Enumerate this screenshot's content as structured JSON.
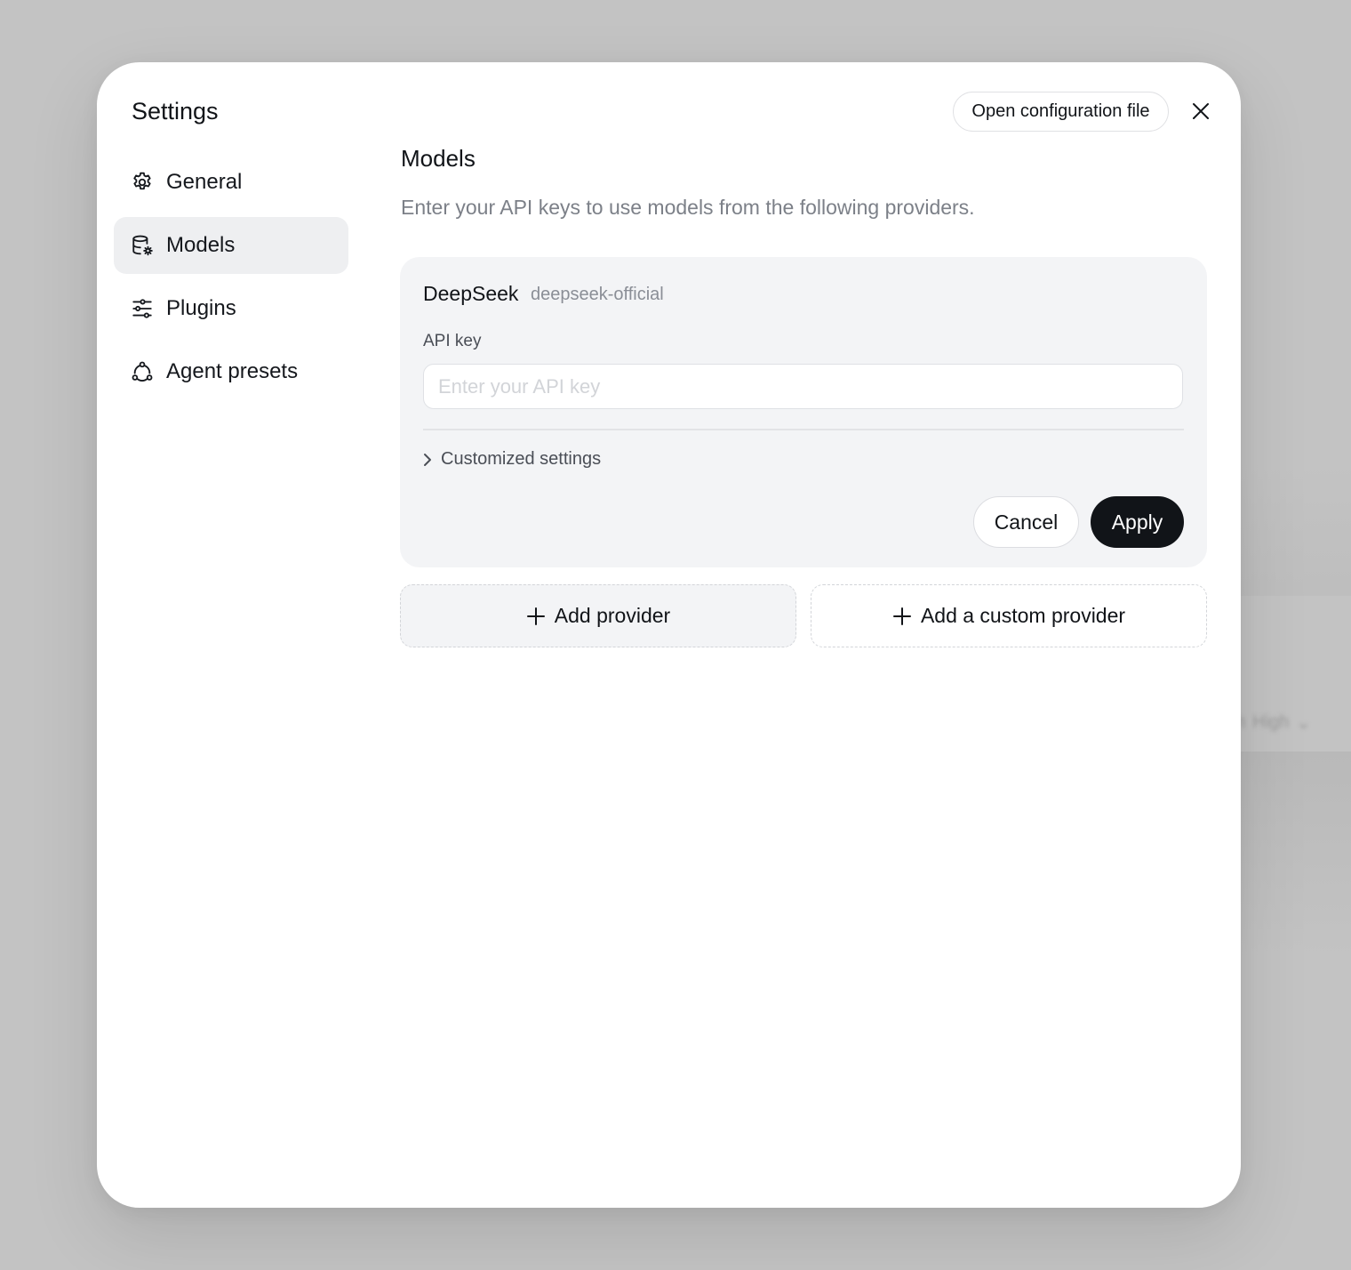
{
  "background": {
    "ghost_text": [
      "sh",
      "High"
    ]
  },
  "modal": {
    "title": "Settings",
    "open_config_label": "Open configuration file",
    "close_icon": "close-icon"
  },
  "sidebar": {
    "items": [
      {
        "label": "General",
        "icon": "gear-icon",
        "active": false
      },
      {
        "label": "Models",
        "icon": "database-gear-icon",
        "active": true
      },
      {
        "label": "Plugins",
        "icon": "sliders-icon",
        "active": false
      },
      {
        "label": "Agent presets",
        "icon": "agents-network-icon",
        "active": false
      }
    ]
  },
  "main": {
    "title": "Models",
    "description": "Enter your API keys to use models from the following providers.",
    "provider": {
      "name": "DeepSeek",
      "id": "deepseek-official",
      "api_key_label": "API key",
      "api_key_value": "",
      "api_key_placeholder": "Enter your API key",
      "customized_label": "Customized settings",
      "cancel_label": "Cancel",
      "apply_label": "Apply"
    },
    "add_provider_label": "Add provider",
    "add_custom_provider_label": "Add a custom provider"
  },
  "colors": {
    "accent": "#111418",
    "muted_text": "#7c8088",
    "card_bg": "#f3f4f6",
    "active_nav_bg": "#eeeff1"
  }
}
